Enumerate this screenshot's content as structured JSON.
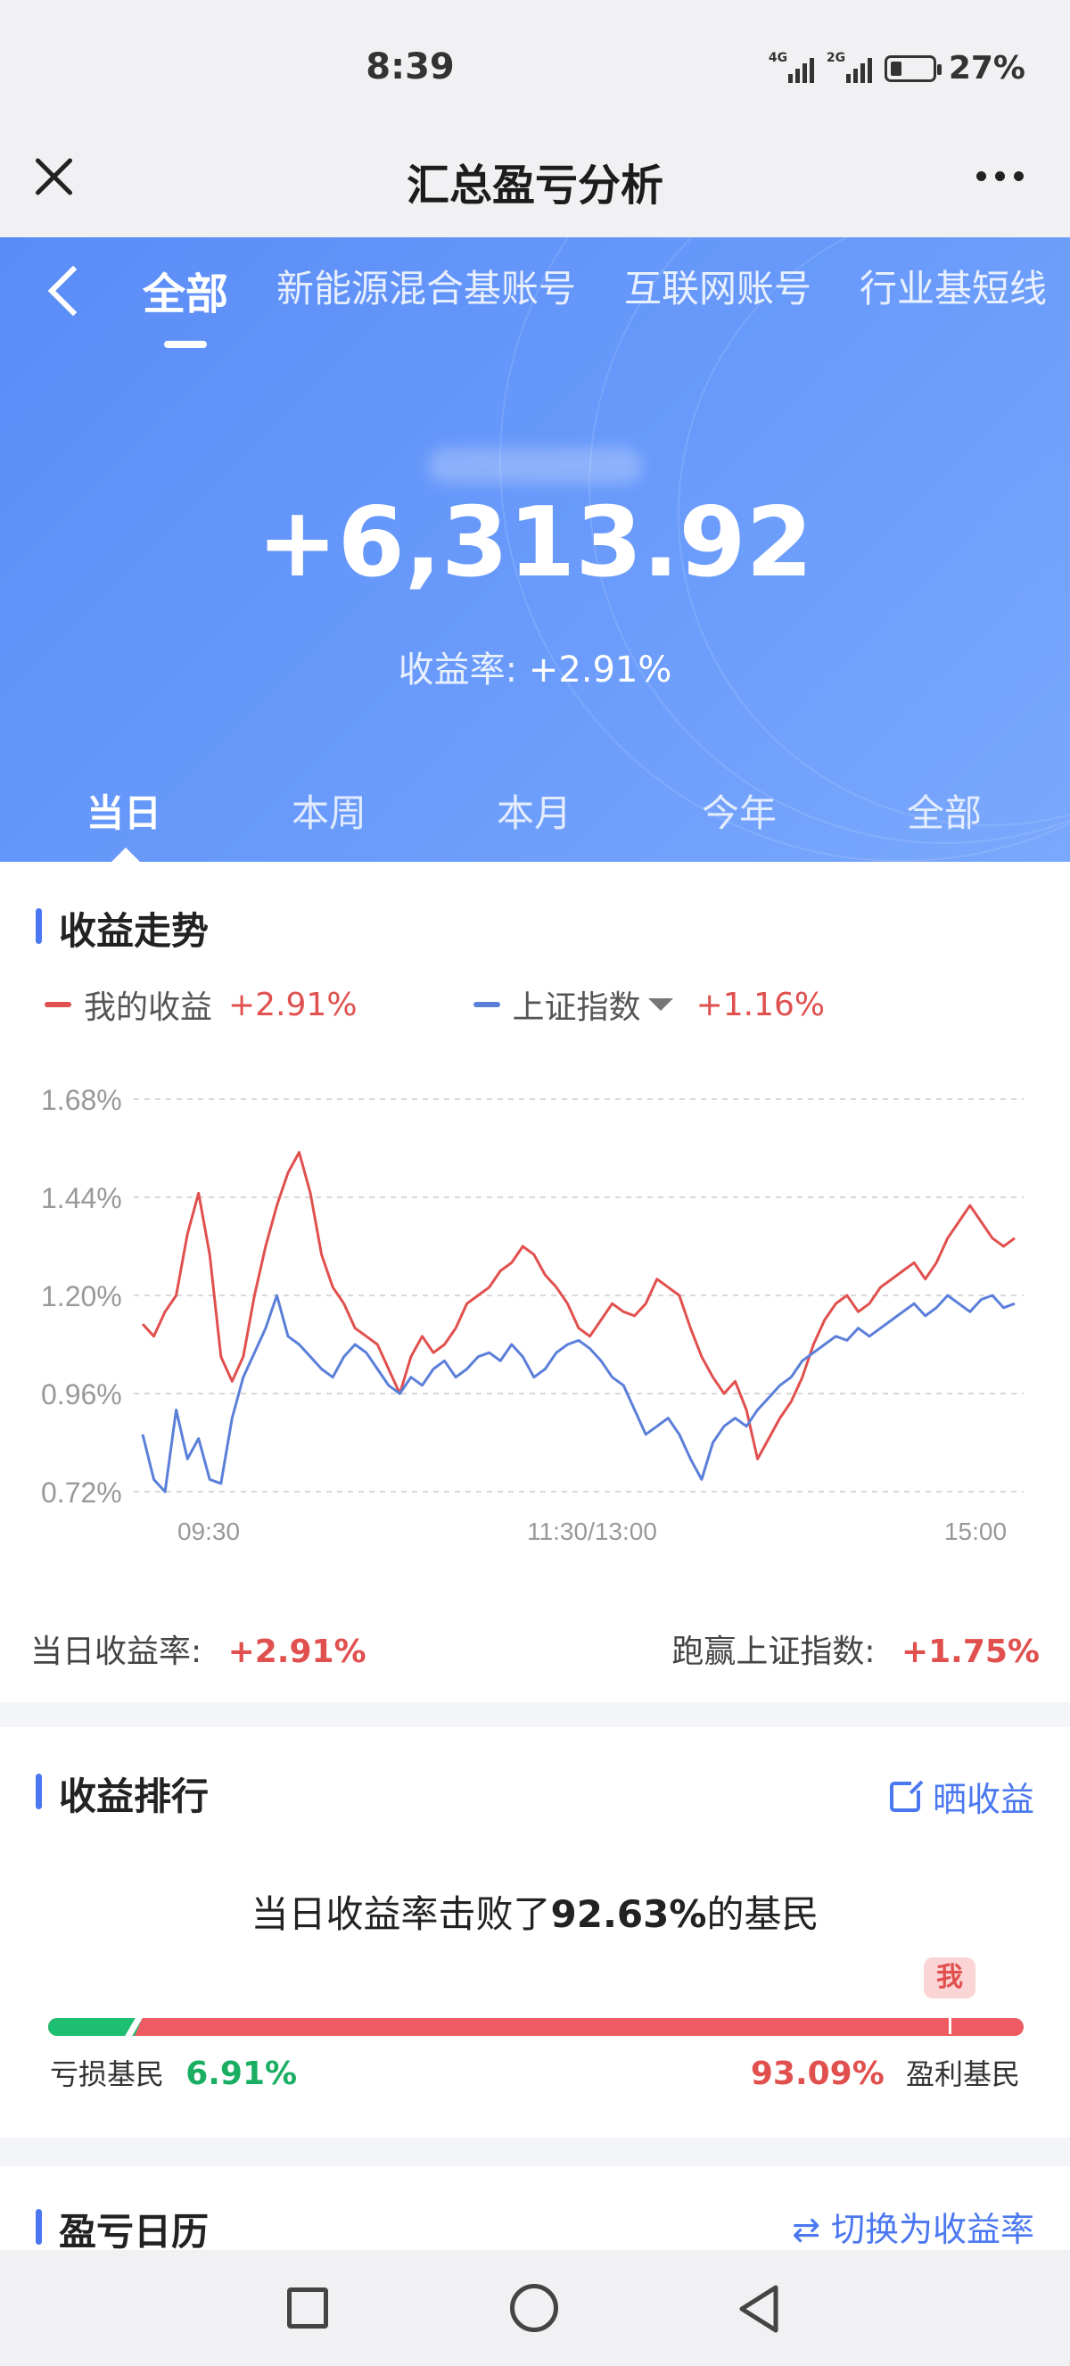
{
  "status_bar": {
    "time": "8:39",
    "net1": "4G",
    "net2": "2G",
    "battery": "27%"
  },
  "header": {
    "title": "汇总盈亏分析"
  },
  "account_tabs": [
    "全部",
    "新能源混合基账号",
    "互联网账号",
    "行业基短线"
  ],
  "summary": {
    "profit": "+6,313.92",
    "rate_label": "收益率:",
    "rate_value": "+2.91%"
  },
  "period_tabs": [
    "当日",
    "本周",
    "本月",
    "今年",
    "全部"
  ],
  "trend": {
    "title": "收益走势",
    "legend": [
      {
        "name": "我的收益",
        "value": "+2.91%",
        "color": "#e0504e"
      },
      {
        "name": "上证指数",
        "value": "+1.16%",
        "color": "#5b7fd9"
      }
    ],
    "daily_rate_label": "当日收益率:",
    "daily_rate_value": "+2.91%",
    "beat_index_label": "跑赢上证指数:",
    "beat_index_value": "+1.75%"
  },
  "chart_data": {
    "type": "line",
    "y_ticks": [
      "1.68%",
      "1.44%",
      "1.20%",
      "0.96%",
      "0.72%"
    ],
    "ylim": [
      0.72,
      1.68
    ],
    "x_ticks": [
      "09:30",
      "11:30/13:00",
      "15:00"
    ],
    "grid": true,
    "series": [
      {
        "name": "我的收益",
        "color": "#e0504e",
        "values": [
          1.13,
          1.1,
          1.16,
          1.2,
          1.35,
          1.45,
          1.3,
          1.05,
          0.99,
          1.05,
          1.2,
          1.32,
          1.42,
          1.5,
          1.55,
          1.45,
          1.3,
          1.22,
          1.18,
          1.12,
          1.1,
          1.08,
          1.02,
          0.96,
          1.05,
          1.1,
          1.06,
          1.08,
          1.12,
          1.18,
          1.2,
          1.22,
          1.26,
          1.28,
          1.32,
          1.3,
          1.25,
          1.22,
          1.18,
          1.12,
          1.1,
          1.14,
          1.18,
          1.16,
          1.15,
          1.18,
          1.24,
          1.22,
          1.2,
          1.12,
          1.05,
          1.0,
          0.96,
          0.99,
          0.92,
          0.8,
          0.85,
          0.9,
          0.94,
          1.0,
          1.08,
          1.14,
          1.18,
          1.2,
          1.16,
          1.18,
          1.22,
          1.24,
          1.26,
          1.28,
          1.24,
          1.28,
          1.34,
          1.38,
          1.42,
          1.38,
          1.34,
          1.32,
          1.34
        ]
      },
      {
        "name": "上证指数",
        "color": "#5b7fd9",
        "values": [
          0.86,
          0.75,
          0.72,
          0.92,
          0.8,
          0.85,
          0.75,
          0.74,
          0.9,
          1.0,
          1.06,
          1.12,
          1.2,
          1.1,
          1.08,
          1.05,
          1.02,
          1.0,
          1.05,
          1.08,
          1.06,
          1.02,
          0.98,
          0.96,
          1.0,
          0.98,
          1.02,
          1.04,
          1.0,
          1.02,
          1.05,
          1.06,
          1.04,
          1.08,
          1.05,
          1.0,
          1.02,
          1.06,
          1.08,
          1.09,
          1.07,
          1.04,
          1.0,
          0.98,
          0.92,
          0.86,
          0.88,
          0.9,
          0.86,
          0.8,
          0.75,
          0.84,
          0.88,
          0.9,
          0.88,
          0.92,
          0.95,
          0.98,
          1.0,
          1.04,
          1.06,
          1.08,
          1.1,
          1.09,
          1.12,
          1.1,
          1.12,
          1.14,
          1.16,
          1.18,
          1.15,
          1.17,
          1.2,
          1.18,
          1.16,
          1.19,
          1.2,
          1.17,
          1.18
        ]
      }
    ]
  },
  "ranking": {
    "title": "收益排行",
    "share_label": "晒收益",
    "beat_prefix": "当日收益率击败了",
    "beat_value": "92.63%",
    "beat_suffix": "的基民",
    "me_label": "我",
    "loss_label": "亏损基民",
    "loss_value": "6.91%",
    "loss_fraction": 0.0691,
    "profit_label": "盈利基民",
    "profit_value": "93.09%",
    "me_position": 0.9263
  },
  "calendar": {
    "title": "盈亏日历",
    "switch_label": "⇄ 切换为收益率"
  }
}
